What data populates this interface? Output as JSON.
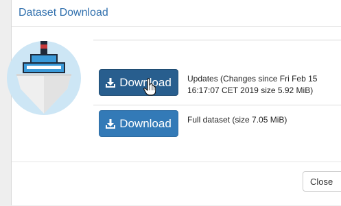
{
  "modal": {
    "title": "Dataset Download"
  },
  "logo": {
    "icon": "ship-icon",
    "circle_color": "#cde6f5",
    "hull_color": "#efefef",
    "cabin_color": "#3b9ad9",
    "funnel_stripe_color": "#c8393b"
  },
  "rows": [
    {
      "button_label": "Download",
      "icon": "download-icon",
      "description_line1": "Updates (Changes since Fri Feb 15",
      "description_line2": "16:17:07 CET 2019 size 5.92 MiB)"
    },
    {
      "button_label": "Download",
      "icon": "download-icon",
      "description": "Full dataset (size 7.05 MiB)"
    }
  ],
  "footer": {
    "close_label": "Close"
  },
  "colors": {
    "primary": "#337ab7",
    "primary_active": "#285e8e",
    "title": "#2f6fad"
  }
}
